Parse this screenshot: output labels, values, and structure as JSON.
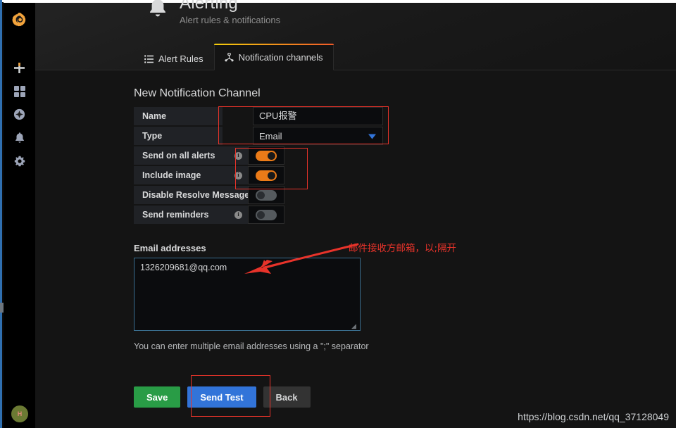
{
  "app": {
    "name": "Grafana",
    "watermark": "https://blog.csdn.net/qq_37128049"
  },
  "sidebar": {
    "logo_icon": "grafana-logo-icon",
    "items": [
      {
        "icon": "plus-icon",
        "label": "Create"
      },
      {
        "icon": "dashboards-grid-icon",
        "label": "Dashboards"
      },
      {
        "icon": "explore-compass-icon",
        "label": "Explore"
      },
      {
        "icon": "bell-icon",
        "label": "Alerting"
      },
      {
        "icon": "gear-icon",
        "label": "Configuration"
      }
    ],
    "avatar_initials": "H"
  },
  "header": {
    "icon": "bell-icon",
    "title": "Alerting",
    "subtitle": "Alert rules & notifications"
  },
  "tabs": [
    {
      "label": "Alert Rules",
      "icon": "list-icon",
      "active": false
    },
    {
      "label": "Notification channels",
      "icon": "share-nodes-icon",
      "active": true
    }
  ],
  "main": {
    "section_title": "New Notification Channel",
    "fields": [
      {
        "label": "Name",
        "type": "text",
        "value": "CPU报警",
        "has_info": false
      },
      {
        "label": "Type",
        "type": "select",
        "value": "Email",
        "has_info": false,
        "caret_icon": "chevron-down-icon"
      },
      {
        "label": "Send on all alerts",
        "type": "switch",
        "value": "on",
        "has_info": true
      },
      {
        "label": "Include image",
        "type": "switch",
        "value": "on",
        "has_info": true
      },
      {
        "label": "Disable Resolve Message",
        "type": "switch",
        "value": "off",
        "has_info": false
      },
      {
        "label": "Send reminders",
        "type": "switch",
        "value": "off",
        "has_info": true
      }
    ],
    "email": {
      "label": "Email addresses",
      "value": "1326209681@qq.com",
      "placeholder": "",
      "hint": "You can enter multiple email addresses using a \";\" separator"
    },
    "buttons": [
      {
        "label": "Save",
        "style": "save"
      },
      {
        "label": "Send Test",
        "style": "test"
      },
      {
        "label": "Back",
        "style": "back"
      }
    ]
  },
  "annotations": {
    "note_text": "邮件接收方邮箱，以;隔开",
    "color": "#e8332a"
  },
  "colors": {
    "accent_orange": "#eb7b18",
    "primary_blue": "#3274d9",
    "success_green": "#299c46",
    "annotation_red": "#e8332a"
  }
}
